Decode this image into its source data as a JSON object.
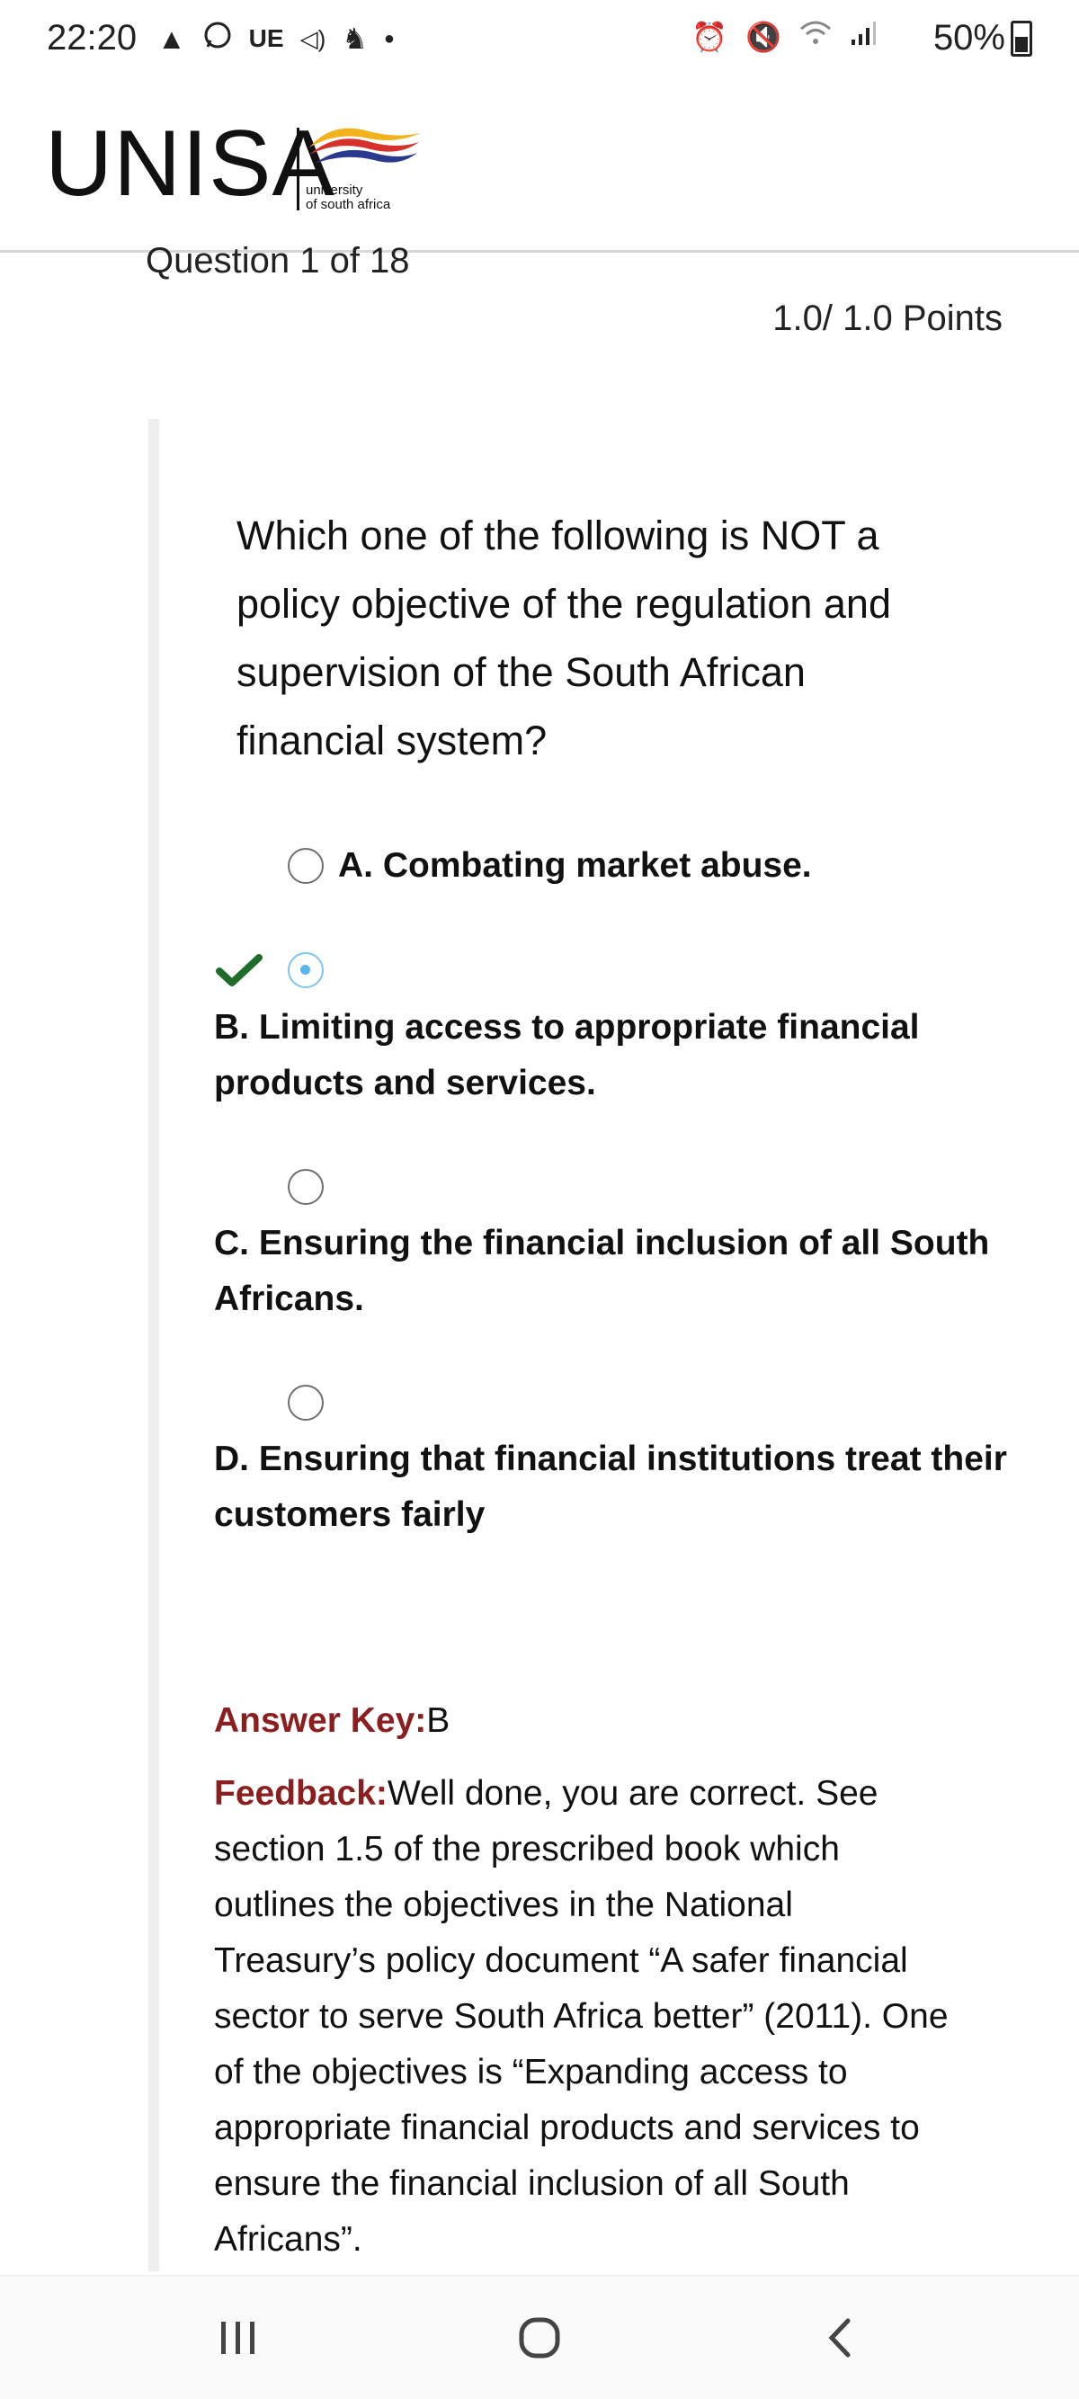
{
  "status_bar": {
    "time": "22:20",
    "left_icons": [
      "warning-icon",
      "whatsapp-icon",
      "ue-badge",
      "cast-icon",
      "ninja-icon",
      "dot"
    ],
    "left_text_badge": "UE",
    "battery_percent": "50%"
  },
  "header": {
    "logo_text": "UNISA",
    "logo_tagline_1": "university",
    "logo_tagline_2": "of south africa"
  },
  "question": {
    "counter": "Question 1 of 18",
    "points": "1.0/ 1.0 Points",
    "text": "Which one of the following is NOT a policy objective of the regulation and supervision of the South African financial system?"
  },
  "options": [
    {
      "label": "A. Combating market abuse.",
      "selected": false,
      "correct": false
    },
    {
      "label": "B. Limiting access to appropriate financial products and services.",
      "selected": true,
      "correct": true
    },
    {
      "label": "C. Ensuring the financial inclusion of all South Africans.",
      "selected": false,
      "correct": false
    },
    {
      "label": "D. Ensuring that financial institutions treat their customers fairly",
      "selected": false,
      "correct": false
    }
  ],
  "answer": {
    "key_label": "Answer Key:",
    "key_value": "B",
    "feedback_label": "Feedback:",
    "feedback_text": "Well done, you are correct. See section 1.5 of the prescribed book which outlines the objectives in the National Treasury’s policy document “A safer financial sector to serve South Africa better” (2011). One of the objectives is “Expanding access to appropriate financial products and services to ensure the financial inclusion of all South Africans”."
  },
  "colors": {
    "accent_red": "#8b1e1e",
    "check_green": "#1e6b2a",
    "radio_selected": "#5bb5ec"
  },
  "nav": {
    "recent_icon": "recent-apps-icon",
    "home_icon": "home-icon",
    "back_icon": "back-icon"
  }
}
